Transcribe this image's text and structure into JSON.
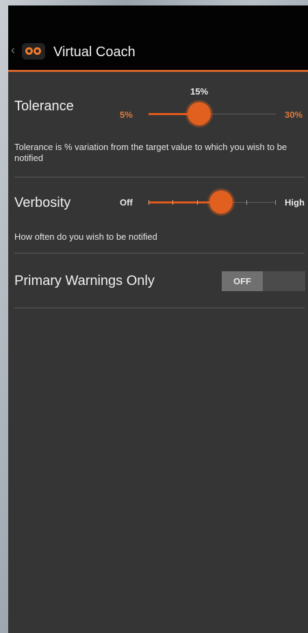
{
  "app": {
    "title": "Virtual Coach",
    "logo_icon": "binoculars-eyes-icon",
    "accent_color": "#e35b1b"
  },
  "tolerance": {
    "title": "Tolerance",
    "min_label": "5%",
    "max_label": "30%",
    "value_label": "15%",
    "value_percent": 15,
    "description": "Tolerance is % variation from the target value to which you wish to be notified"
  },
  "verbosity": {
    "title": "Verbosity",
    "min_label": "Off",
    "max_label": "High",
    "level": 4,
    "level_count": 6,
    "description": "How often do you wish to be notified"
  },
  "primary_warnings": {
    "title": "Primary Warnings Only",
    "toggle_label": "OFF",
    "enabled": false
  }
}
